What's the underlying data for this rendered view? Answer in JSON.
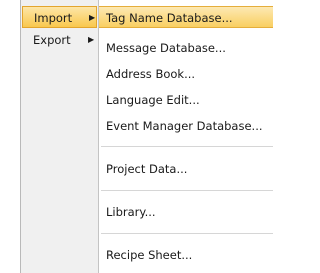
{
  "parent_menu": {
    "items": [
      {
        "label": "Import"
      },
      {
        "label": "Export"
      }
    ],
    "submenu_arrow": "▶"
  },
  "import_submenu": {
    "items": [
      {
        "label": "Tag Name Database..."
      },
      {
        "label": "Message Database..."
      },
      {
        "label": "Address Book..."
      },
      {
        "label": "Language Edit..."
      },
      {
        "label": "Event Manager Database..."
      },
      {
        "label": "Project Data..."
      },
      {
        "label": "Library..."
      },
      {
        "label": "Recipe Sheet..."
      }
    ]
  },
  "colors": {
    "highlight_top": "#fde6a8",
    "highlight_bottom": "#f9c84e",
    "highlight_border": "#e3a52d",
    "menu_background": "#f0f0f0",
    "submenu_background": "#ffffff"
  }
}
